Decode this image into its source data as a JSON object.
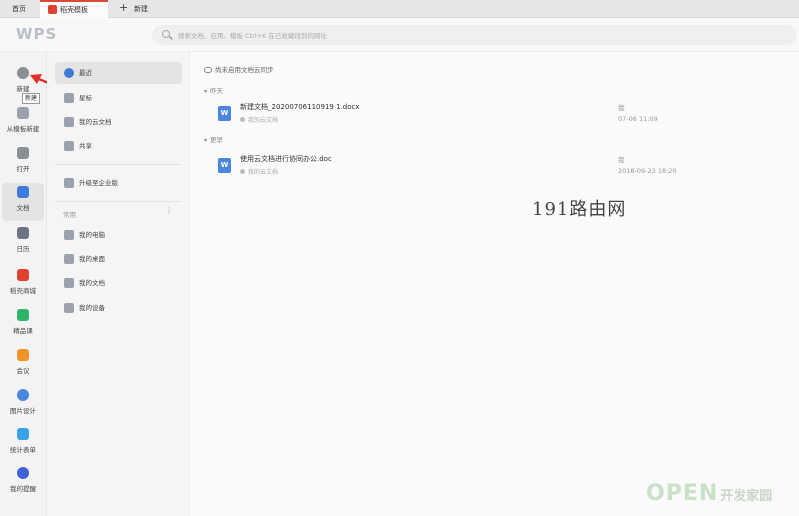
{
  "tabs": {
    "home": "首页",
    "template": "稻壳模板",
    "new": "新建"
  },
  "header": {
    "logo": "WPS",
    "search_placeholder": "搜索文档、应用、模板 Ctrl+K 在已收藏找到的网址"
  },
  "rail": {
    "items": [
      {
        "label": "新建",
        "icon": "plus-circle-icon",
        "color": "#8a8f96"
      },
      {
        "label": "从模板新建",
        "icon": "template-icon",
        "color": "#9aa3ad"
      },
      {
        "label": "打开",
        "icon": "folder-icon",
        "color": "#8a8f96"
      },
      {
        "label": "文档",
        "icon": "document-icon",
        "color": "#3f7cd9"
      },
      {
        "label": "日历",
        "icon": "calendar-icon",
        "color": "#6b7480"
      },
      {
        "label": "稻壳商城",
        "icon": "docer-icon",
        "color": "#e2402f"
      },
      {
        "label": "精品课",
        "icon": "graduation-cap-icon",
        "color": "#2fb46b"
      },
      {
        "label": "会议",
        "icon": "meeting-icon",
        "color": "#f0932b"
      },
      {
        "label": "图片设计",
        "icon": "image-design-icon",
        "color": "#4a86de"
      },
      {
        "label": "统计表单",
        "icon": "form-icon",
        "color": "#3aa3e3"
      },
      {
        "label": "我的提醒",
        "icon": "reminder-icon",
        "color": "#3f62d9"
      }
    ],
    "tooltip": "新建"
  },
  "sidebar": {
    "items": [
      {
        "label": "最近",
        "icon": "clock-icon"
      },
      {
        "label": "星标",
        "icon": "star-icon"
      },
      {
        "label": "我的云文档",
        "icon": "cloud-icon"
      },
      {
        "label": "共享",
        "icon": "share-icon"
      }
    ],
    "upgrade": "升级至企业版",
    "section_title": "常用",
    "common": [
      {
        "label": "我的电脑",
        "icon": "computer-icon"
      },
      {
        "label": "我的桌面",
        "icon": "desktop-icon"
      },
      {
        "label": "我的文档",
        "icon": "my-documents-icon"
      },
      {
        "label": "我的设备",
        "icon": "device-icon"
      }
    ]
  },
  "main": {
    "cloud_hint": "尚未启用文档云同步",
    "groups": [
      {
        "title": "昨天",
        "files": [
          {
            "name": "新建文档_20200706110919 1.docx",
            "location": "我的云文档",
            "owner": "我",
            "time": "07-06 11:09"
          }
        ]
      },
      {
        "title": "更早",
        "files": [
          {
            "name": "使用云文档进行协同办公.doc",
            "location": "我的云文档",
            "owner": "我",
            "time": "2018-09-23 18:20"
          }
        ]
      }
    ]
  },
  "watermarks": {
    "site": "191路由网",
    "brand": "OPEN",
    "brand_cn": "开发家园"
  }
}
